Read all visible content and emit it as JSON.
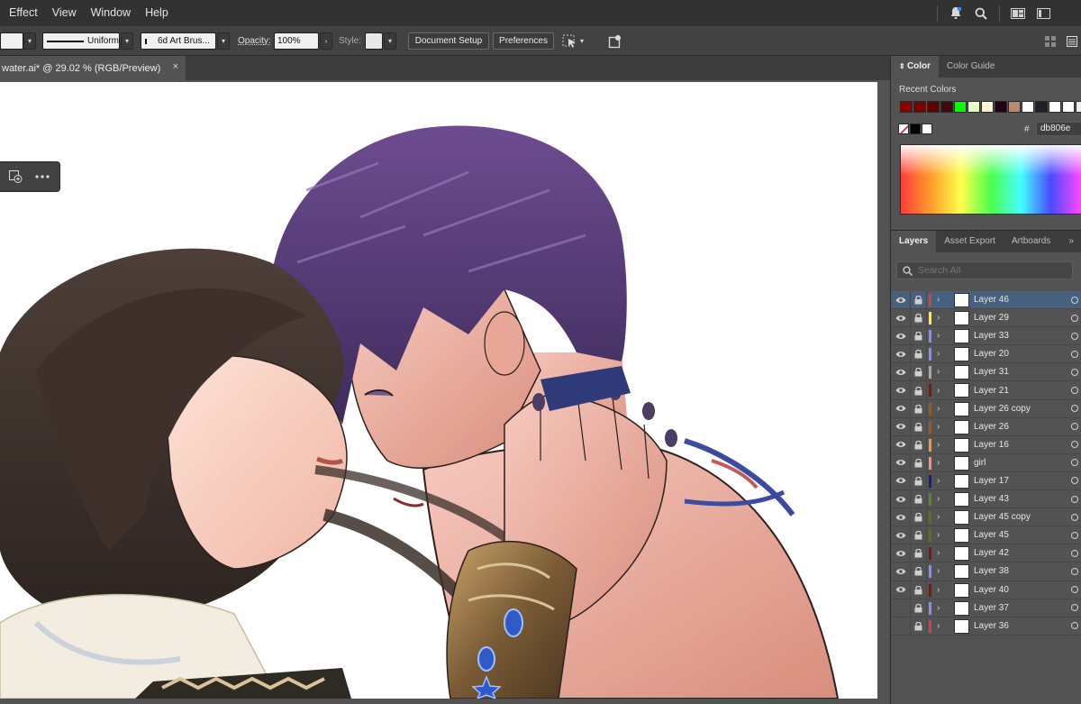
{
  "menubar": {
    "items": [
      "Effect",
      "View",
      "Window",
      "Help"
    ]
  },
  "controlbar": {
    "stroke_style": "Uniform",
    "brush": "6d Art Brus...",
    "opacity_label": "Opacity:",
    "opacity_value": "100%",
    "style_label": "Style:",
    "document_setup": "Document Setup",
    "preferences": "Preferences"
  },
  "document_tab": {
    "title": "water.ai* @ 29.02 % (RGB/Preview)",
    "close": "×"
  },
  "color_panel": {
    "tabs": [
      "Color",
      "Color Guide"
    ],
    "recent_label": "Recent Colors",
    "recent_swatches": [
      "#8c0000",
      "#7a0000",
      "#600000",
      "#3e0a0a",
      "#00ff00",
      "#e4ffc4",
      "#fff3d8",
      "#22001a",
      "#b88a6a",
      "#ffffff",
      "#1f1f2a",
      "#ffffff",
      "#ffffff",
      "#eeeeee"
    ],
    "hash": "#",
    "hex_value": "db806e"
  },
  "layers_panel": {
    "tabs": [
      "Layers",
      "Asset Export",
      "Artboards"
    ],
    "collapse": "»",
    "search_placeholder": "Search All",
    "layers": [
      {
        "name": "Layer 46",
        "color": "#e03c3c",
        "visible": true,
        "selected": true
      },
      {
        "name": "Layer 29",
        "color": "#ffee33",
        "visible": true
      },
      {
        "name": "Layer 33",
        "color": "#8a8aff",
        "visible": true
      },
      {
        "name": "Layer 20",
        "color": "#8a8aff",
        "visible": true
      },
      {
        "name": "Layer 31",
        "color": "#a9a9a9",
        "visible": true
      },
      {
        "name": "Layer 21",
        "color": "#8c1010",
        "visible": true
      },
      {
        "name": "Layer 26 copy",
        "color": "#a05a10",
        "visible": true
      },
      {
        "name": "Layer 26",
        "color": "#a05a10",
        "visible": true
      },
      {
        "name": "Layer 16",
        "color": "#ff9922",
        "visible": true
      },
      {
        "name": "girl",
        "color": "#ff8a8a",
        "visible": true
      },
      {
        "name": "Layer 17",
        "color": "#1a1a99",
        "visible": true
      },
      {
        "name": "Layer 43",
        "color": "#5a8a1a",
        "visible": true
      },
      {
        "name": "Layer 45 copy",
        "color": "#6a6a10",
        "visible": true
      },
      {
        "name": "Layer 45",
        "color": "#6a6a10",
        "visible": true
      },
      {
        "name": "Layer 42",
        "color": "#8c1010",
        "visible": true
      },
      {
        "name": "Layer 38",
        "color": "#8a8aff",
        "visible": true
      },
      {
        "name": "Layer 40",
        "color": "#8c1010",
        "visible": true
      },
      {
        "name": "Layer 37",
        "color": "#8a8aff",
        "visible": false
      },
      {
        "name": "Layer 36",
        "color": "#e03c3c",
        "visible": false
      }
    ]
  }
}
